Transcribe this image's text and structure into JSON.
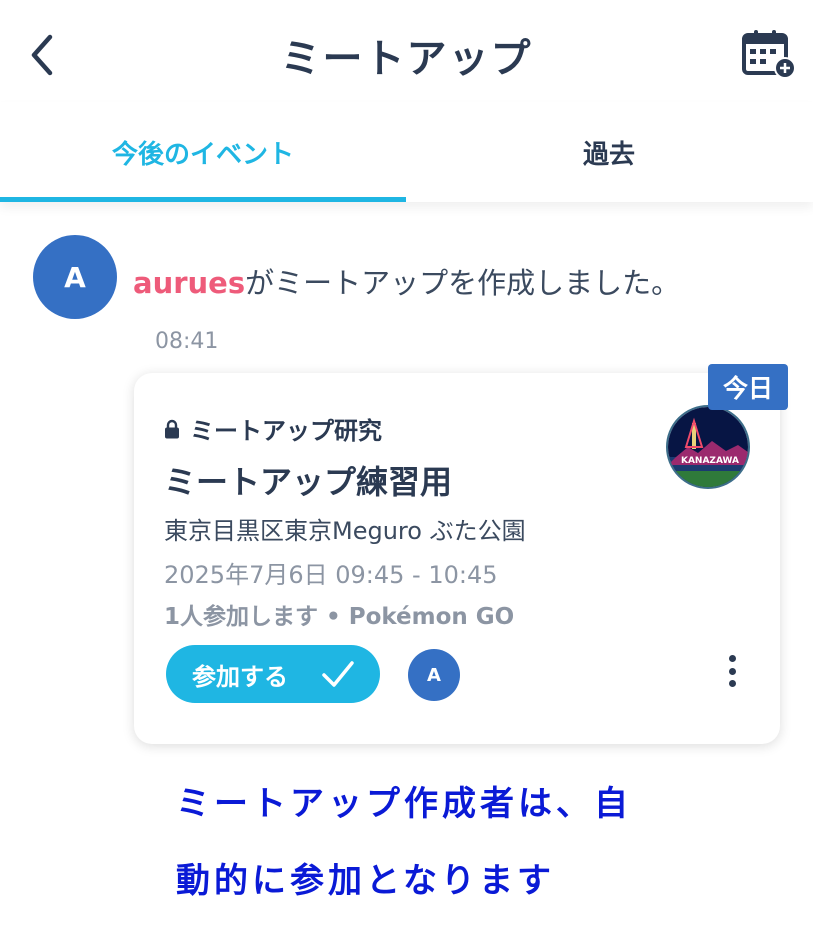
{
  "header": {
    "title": "ミートアップ",
    "back_icon": "chevron-left-icon",
    "calendar_icon": "calendar-add-icon"
  },
  "tabs": [
    {
      "label": "今後のイベント",
      "active": true
    },
    {
      "label": "過去",
      "active": false
    }
  ],
  "activity": {
    "avatar_initial": "A",
    "username": "aurues",
    "message": "がミートアップを作成しました。",
    "time": "08:41"
  },
  "event": {
    "badge": "今日",
    "community": "ミートアップ研究",
    "name": "ミートアップ練習用",
    "location": "東京目黒区東京Meguro ぶた公園",
    "datetime": "2025年7月6日  09:45 - 10:45",
    "participants": "1人参加します • Pokémon GO",
    "join_label": "参加する",
    "attendee_initial": "A",
    "image_text": "KANAZAWA"
  },
  "annotation": {
    "line1": "ミートアップ作成者は、自",
    "line2": "動的に参加となります"
  },
  "colors": {
    "accent": "#1fb6e3",
    "avatar": "#3570c4",
    "username": "#ee5b7a",
    "annotation": "#0a1ad6",
    "text": "#2b3a52"
  }
}
